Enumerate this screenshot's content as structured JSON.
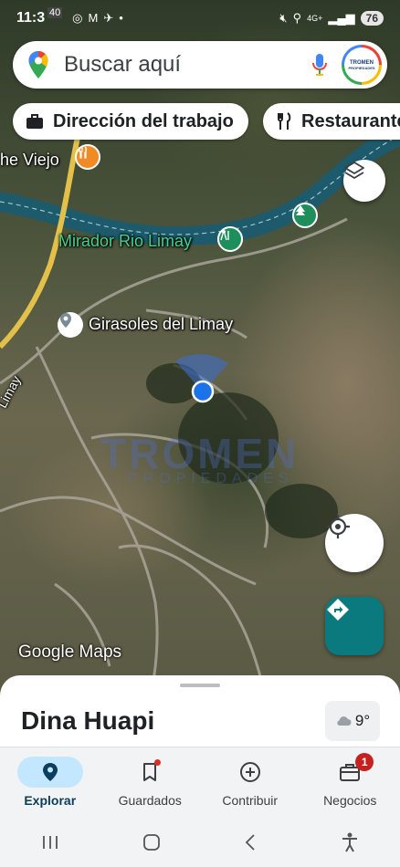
{
  "status_bar": {
    "time": "11:3",
    "time_overlay": "40",
    "signal": "4G+",
    "battery": "76"
  },
  "search": {
    "placeholder": "Buscar aquí",
    "avatar_text_top": "TROMEN",
    "avatar_text_bottom": "PROPIEDADES"
  },
  "chips": [
    {
      "label": "Dirección del trabajo",
      "icon": "briefcase-icon"
    },
    {
      "label": "Restaurante",
      "icon": "fork-knife-icon"
    }
  ],
  "map": {
    "labels": {
      "the_viejo": "he Viejo",
      "mirador": "Mirador Rio Limay",
      "girasoles": "Girasoles del Limay",
      "limay_road": "Limay"
    },
    "watermark_text": "TROMEN",
    "watermark_sub": "PROPIEDADES",
    "attribution": "Google Maps",
    "colors": {
      "river": "#1d5a6b",
      "park_label": "#4bd08a",
      "road": "#e3c04a",
      "location_dot": "#1a73e8"
    }
  },
  "sheet": {
    "place_title": "Dina Huapi",
    "weather_temp": "9°"
  },
  "bottom_nav": [
    {
      "label": "Explorar",
      "icon": "location-pin-icon",
      "active": true
    },
    {
      "label": "Guardados",
      "icon": "bookmark-icon",
      "active": false
    },
    {
      "label": "Contribuir",
      "icon": "add-circle-icon",
      "active": false
    },
    {
      "label": "Negocios",
      "icon": "store-icon",
      "active": false,
      "badge": "1"
    }
  ]
}
